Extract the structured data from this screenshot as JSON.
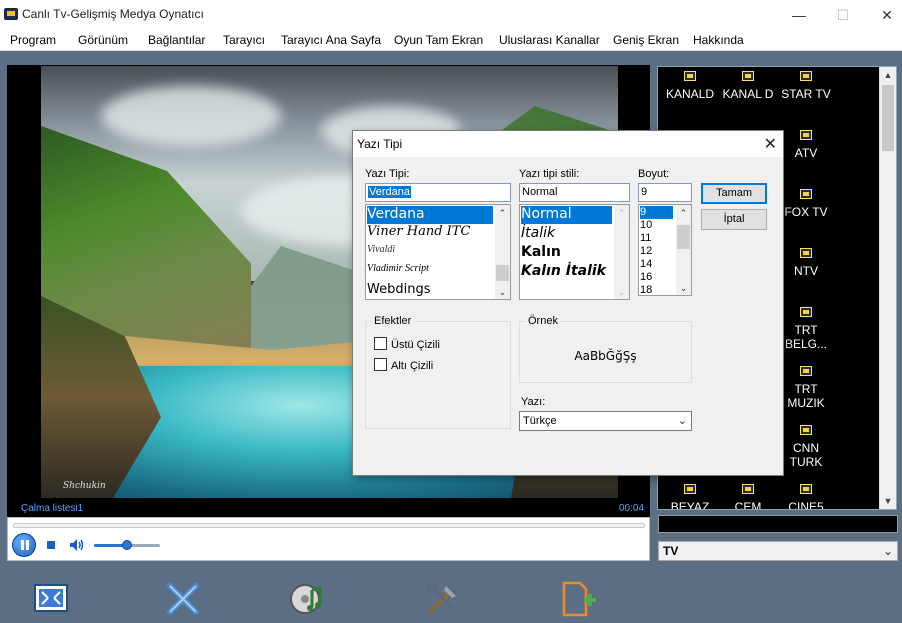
{
  "window": {
    "title": "Canlı Tv-Gelişmiş Medya Oynatıcı",
    "min_glyph": "—",
    "max_glyph": "☐",
    "close_glyph": "✕"
  },
  "menu": [
    "Program",
    "Görünüm",
    "Bağlantılar",
    "Tarayıcı",
    "Tarayıcı Ana Sayfa",
    "Oyun Tam Ekran",
    "Uluslarası Kanallar",
    "Geniş Ekran",
    "Hakkında"
  ],
  "player": {
    "watermark": "Shchukin",
    "playlist_label": "Çalma listesi1",
    "time": "00:04",
    "volume_level": 0.5
  },
  "channels": [
    {
      "name": "KANALD",
      "icon": "tv-icon"
    },
    {
      "name": "KANAL D",
      "icon": "tv-icon"
    },
    {
      "name": "STAR TV",
      "icon": "tv-icon"
    },
    {
      "name": "ATV",
      "icon": "tv-icon"
    },
    {
      "name": "FOX TV",
      "icon": "tv-icon"
    },
    {
      "name": "NTV",
      "icon": "tv-icon"
    },
    {
      "name": "TRT BELG...",
      "icon": "tv-icon"
    },
    {
      "name": "TRT MUZIK",
      "icon": "tv-icon"
    },
    {
      "name": "CNN TURK",
      "icon": "tv-icon"
    },
    {
      "name": "BEYAZ",
      "icon": "tv-icon"
    },
    {
      "name": "CEM",
      "icon": "tv-icon"
    },
    {
      "name": "CINE5",
      "icon": "tv-icon"
    }
  ],
  "channel_select": {
    "value": "TV"
  },
  "font_dialog": {
    "title": "Yazı Tipi",
    "font_label": "Yazı Tipi:",
    "font_value": "Verdana",
    "font_list": [
      "Verdana",
      "Viner Hand ITC",
      "Vivaldi",
      "Vladimir Script",
      "Webdings"
    ],
    "style_label": "Yazı tipi stili:",
    "style_value": "Normal",
    "style_list": [
      "Normal",
      "İtalik",
      "Kalın",
      "Kalın İtalik"
    ],
    "size_label": "Boyut:",
    "size_value": "9",
    "size_list": [
      "9",
      "10",
      "11",
      "12",
      "14",
      "16",
      "18"
    ],
    "ok_button": "Tamam",
    "cancel_button": "İptal",
    "effects_title": "Efektler",
    "strikeout_label": "Üstü Çizili",
    "underline_label": "Altı Çizili",
    "sample_title": "Örnek",
    "sample_text": "AaBbĞğŞş",
    "script_label": "Yazı:",
    "script_value": "Türkçe"
  }
}
